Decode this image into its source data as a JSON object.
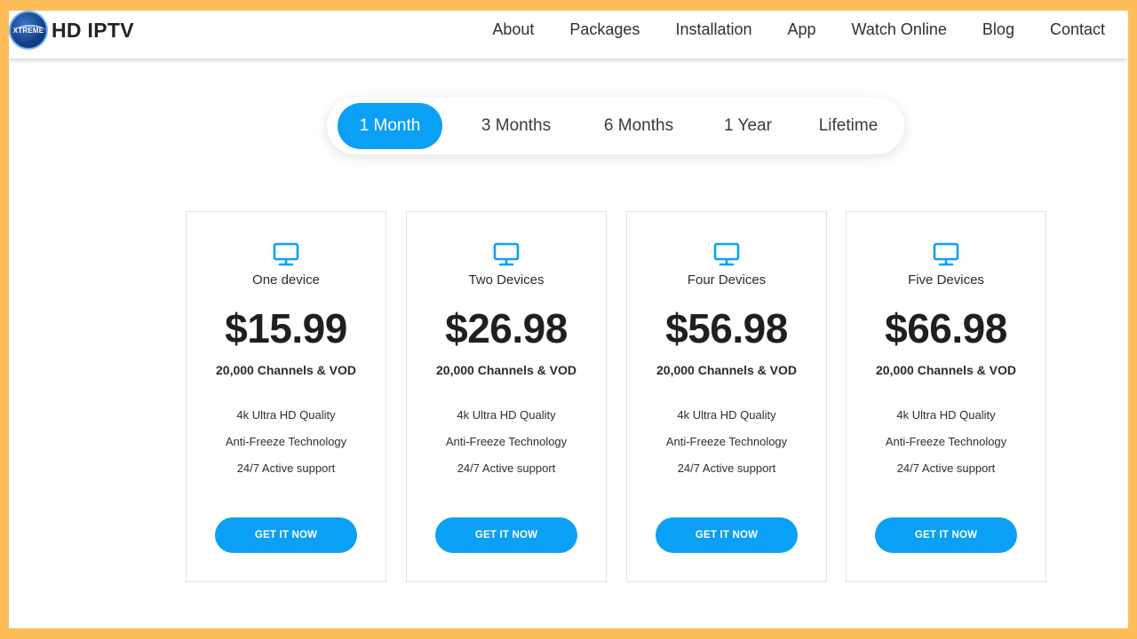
{
  "brand": {
    "badge_text": "XTREME",
    "name": "HD IPTV"
  },
  "nav": [
    "About",
    "Packages",
    "Installation",
    "App",
    "Watch Online",
    "Blog",
    "Contact"
  ],
  "tabs": [
    {
      "label": "1 Month",
      "active": true
    },
    {
      "label": "3 Months",
      "active": false
    },
    {
      "label": "6 Months",
      "active": false
    },
    {
      "label": "1 Year",
      "active": false
    },
    {
      "label": "Lifetime",
      "active": false
    }
  ],
  "plans": [
    {
      "icon": "monitor-icon",
      "title": "One device",
      "price": "$15.99",
      "channels": "20,000 Channels & VOD",
      "features": [
        "4k Ultra HD Quality",
        "Anti-Freeze Technology",
        "24/7 Active support"
      ],
      "cta": "GET IT NOW"
    },
    {
      "icon": "monitor-icon",
      "title": "Two Devices",
      "price": "$26.98",
      "channels": "20,000 Channels & VOD",
      "features": [
        "4k Ultra HD Quality",
        "Anti-Freeze Technology",
        "24/7 Active support"
      ],
      "cta": "GET IT NOW"
    },
    {
      "icon": "monitor-icon",
      "title": "Four Devices",
      "price": "$56.98",
      "channels": "20,000 Channels & VOD",
      "features": [
        "4k Ultra HD Quality",
        "Anti-Freeze Technology",
        "24/7 Active support"
      ],
      "cta": "GET IT NOW"
    },
    {
      "icon": "monitor-icon",
      "title": "Five Devices",
      "price": "$66.98",
      "channels": "20,000 Channels & VOD",
      "features": [
        "4k Ultra HD Quality",
        "Anti-Freeze Technology",
        "24/7 Active support"
      ],
      "cta": "GET IT NOW"
    }
  ],
  "colors": {
    "accent": "#0aa0f5",
    "border_frame": "#ffbd59",
    "text": "#2b2b2b"
  }
}
